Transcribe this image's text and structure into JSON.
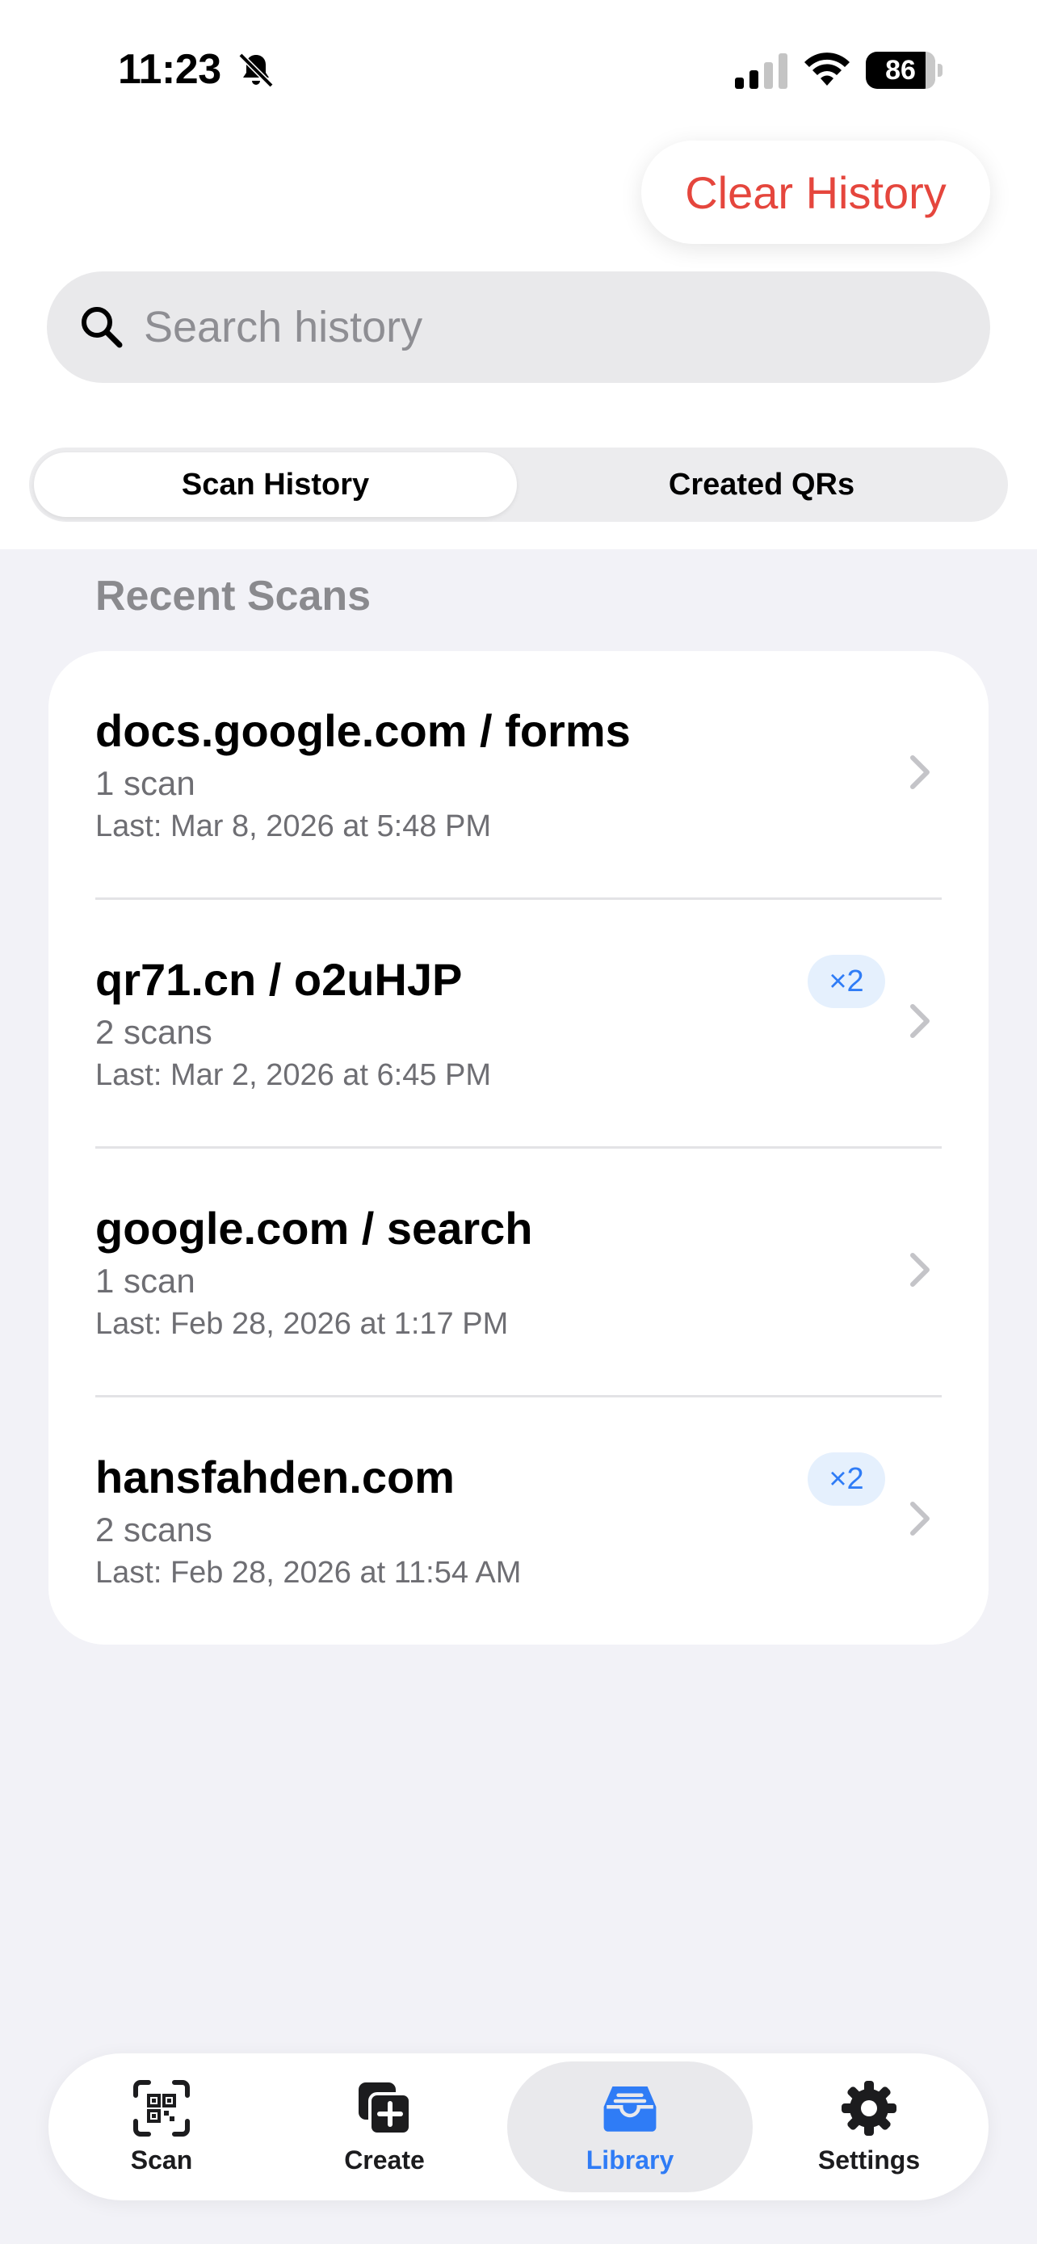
{
  "status_bar": {
    "time": "11:23",
    "battery": "86"
  },
  "header": {
    "clear_label": "Clear History"
  },
  "search": {
    "placeholder": "Search history",
    "value": ""
  },
  "segments": [
    {
      "label": "Scan History",
      "selected": true
    },
    {
      "label": "Created QRs",
      "selected": false
    }
  ],
  "section": {
    "title": "Recent Scans"
  },
  "scans": [
    {
      "title": "docs.google.com / forms",
      "count": "1 scan",
      "last": "Last: Mar 8, 2026 at 5:48 PM",
      "badge": ""
    },
    {
      "title": "qr71.cn / o2uHJP",
      "count": "2 scans",
      "last": "Last: Mar 2, 2026 at 6:45 PM",
      "badge": "×2"
    },
    {
      "title": "google.com / search",
      "count": "1 scan",
      "last": "Last: Feb 28, 2026 at 1:17 PM",
      "badge": ""
    },
    {
      "title": "hansfahden.com",
      "count": "2 scans",
      "last": "Last: Feb 28, 2026 at 11:54 AM",
      "badge": "×2"
    }
  ],
  "tabbar": {
    "items": [
      {
        "label": "Scan",
        "icon": "qr-scan-icon"
      },
      {
        "label": "Create",
        "icon": "create-plus-icon"
      },
      {
        "label": "Library",
        "icon": "tray-icon",
        "active": true
      },
      {
        "label": "Settings",
        "icon": "gear-icon"
      }
    ]
  },
  "colors": {
    "accent": "#2f7cf6",
    "destructive": "#e5463d",
    "background": "#f2f2f7"
  }
}
